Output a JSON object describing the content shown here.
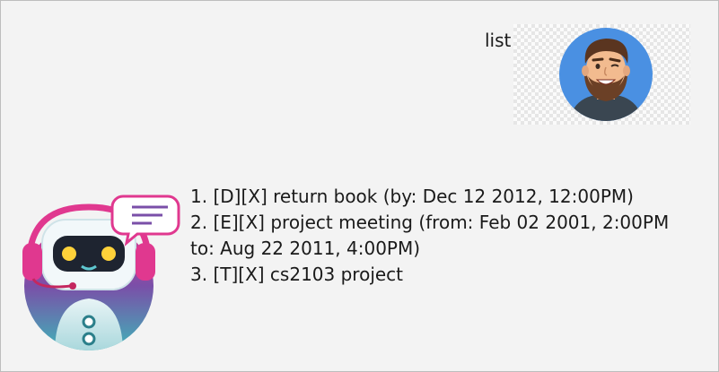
{
  "user": {
    "message": "list",
    "avatar_icon": "man-avatar-icon"
  },
  "bot": {
    "avatar_icon": "robot-avatar-icon",
    "lines": [
      "1. [D][X] return book (by: Dec 12 2012, 12:00PM)",
      "2. [E][X] project meeting (from: Feb 02 2001, 2:00PM",
      "to: Aug 22 2011, 4:00PM)",
      "3. [T][X] cs2103 project"
    ]
  },
  "colors": {
    "background": "#f3f3f3",
    "user_avatar_bg": "#4a90e2",
    "bot_avatar_gradient_top": "#e0388f",
    "bot_avatar_gradient_bottom": "#3fb3b8"
  }
}
